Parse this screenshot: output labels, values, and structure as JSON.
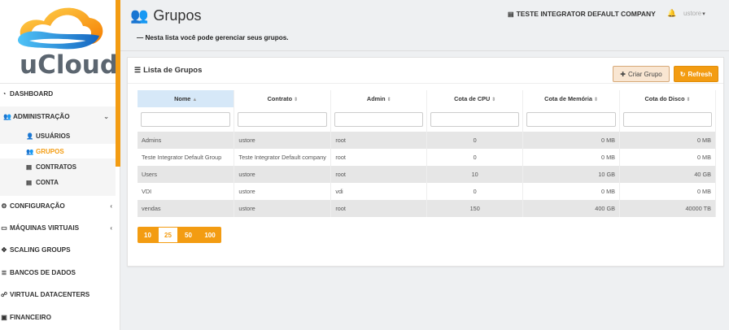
{
  "app": {
    "logo_text": "uCloud",
    "brand_color": "#f39c12",
    "accent_blue": "#1e88e5"
  },
  "sidebar": {
    "items": [
      {
        "icon": "dashboard-icon",
        "label": "DASHBOARD"
      },
      {
        "icon": "group-icon",
        "label": "ADMINISTRAÇÃO",
        "expanded": true
      },
      {
        "icon": "gear-icon",
        "label": "CONFIGURAÇÃO"
      },
      {
        "icon": "monitor-icon",
        "label": "MÁQUINAS VIRTUAIS"
      },
      {
        "icon": "move-icon",
        "label": "SCALING GROUPS"
      },
      {
        "icon": "database-icon",
        "label": "BANCOS DE DADOS"
      },
      {
        "icon": "sitemap-icon",
        "label": "VIRTUAL DATACENTERS"
      },
      {
        "icon": "money-icon",
        "label": "FINANCEIRO"
      }
    ],
    "admin_sub": [
      {
        "icon": "user-icon",
        "label": "USUÁRIOS"
      },
      {
        "icon": "group-icon",
        "label": "GRUPOS",
        "active": true
      },
      {
        "icon": "card-icon",
        "label": "CONTRATOS"
      },
      {
        "icon": "card-icon",
        "label": "CONTA"
      }
    ]
  },
  "header": {
    "title": "Grupos",
    "subtitle": "— Nesta lista você pode gerenciar seus grupos.",
    "company": "TESTE INTEGRATOR DEFAULT COMPANY",
    "user": "ustore"
  },
  "panel": {
    "title": "Lista de Grupos",
    "create_label": "Criar Grupo",
    "refresh_label": "Refresh"
  },
  "table": {
    "columns": [
      "Nome",
      "Contrato",
      "Admin",
      "Cota de CPU",
      "Cota de Memória",
      "Cota do Disco"
    ],
    "rows": [
      [
        "Admins",
        "ustore",
        "root",
        "0",
        "0 MB",
        "0 MB"
      ],
      [
        "Teste Integrator Default Group",
        "Teste Integrator Default company",
        "root",
        "0",
        "0 MB",
        "0 MB"
      ],
      [
        "Users",
        "ustore",
        "root",
        "10",
        "10 GB",
        "40 GB"
      ],
      [
        "VDI",
        "ustore",
        "vdi",
        "0",
        "0 MB",
        "0 MB"
      ],
      [
        "vendas",
        "ustore",
        "root",
        "150",
        "400 GB",
        "40000 TB"
      ]
    ]
  },
  "pager": {
    "sizes": [
      "10",
      "25",
      "50",
      "100"
    ],
    "selected": "25"
  }
}
